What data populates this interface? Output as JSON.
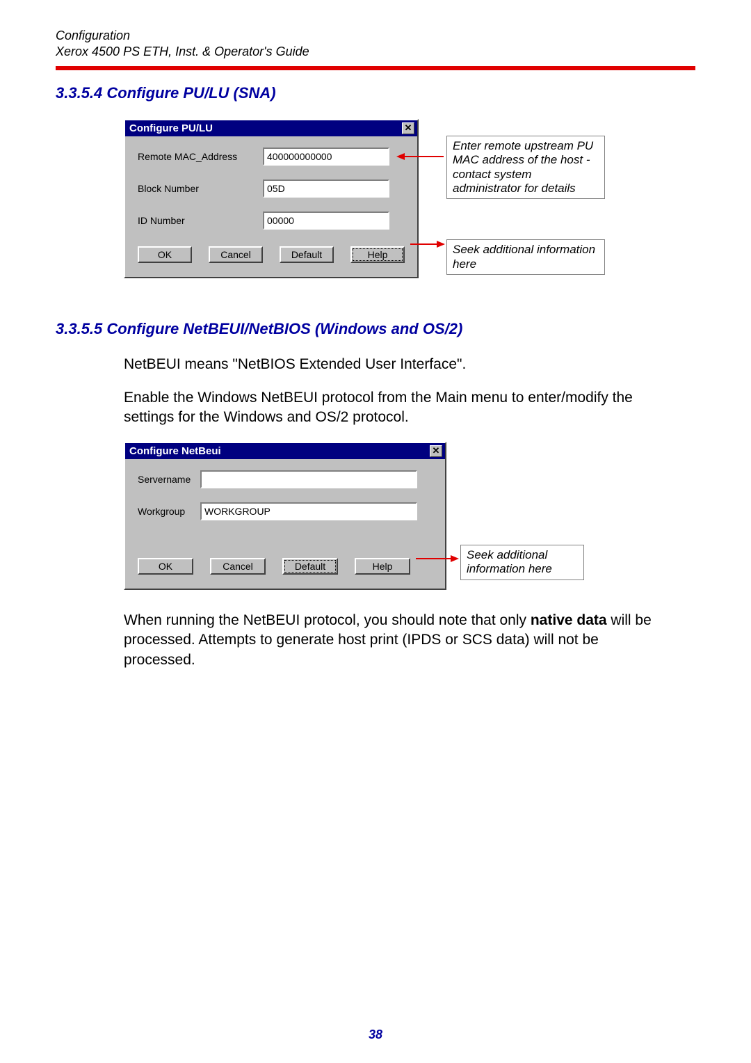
{
  "header": {
    "line1": "Configuration",
    "line2": "Xerox 4500 PS ETH, Inst. & Operator's Guide"
  },
  "section1": {
    "heading": "3.3.5.4 Configure PU/LU (SNA)",
    "dialog": {
      "title": "Configure PU/LU",
      "fields": {
        "remote_mac_label": "Remote MAC_Address",
        "remote_mac_value": "400000000000",
        "block_label": "Block Number",
        "block_value": "05D",
        "id_label": "ID Number",
        "id_value": "00000"
      },
      "buttons": {
        "ok": "OK",
        "cancel": "Cancel",
        "default": "Default",
        "help": "Help"
      }
    },
    "callout1": "Enter remote upstream PU MAC address of the host - contact system administrator for details",
    "callout2": "Seek additional information here"
  },
  "section2": {
    "heading": "3.3.5.5 Configure NetBEUI/NetBIOS (Windows and OS/2)",
    "para1": "NetBEUI means \"NetBIOS Extended User Interface\".",
    "para2": "Enable the Windows NetBEUI protocol from the Main menu to enter/modify the settings for the Windows and OS/2 protocol.",
    "dialog": {
      "title": "Configure NetBeui",
      "fields": {
        "servername_label": "Servername",
        "servername_value": "",
        "workgroup_label": "Workgroup",
        "workgroup_value": "WORKGROUP"
      },
      "buttons": {
        "ok": "OK",
        "cancel": "Cancel",
        "default": "Default",
        "help": "Help"
      }
    },
    "callout1": "Seek additional information here",
    "para3_a": "When running the NetBEUI protocol, you should note that only ",
    "para3_b": "native data",
    "para3_c": " will be processed. Attempts to generate host print (IPDS or SCS data) will not be processed."
  },
  "page_number": "38"
}
